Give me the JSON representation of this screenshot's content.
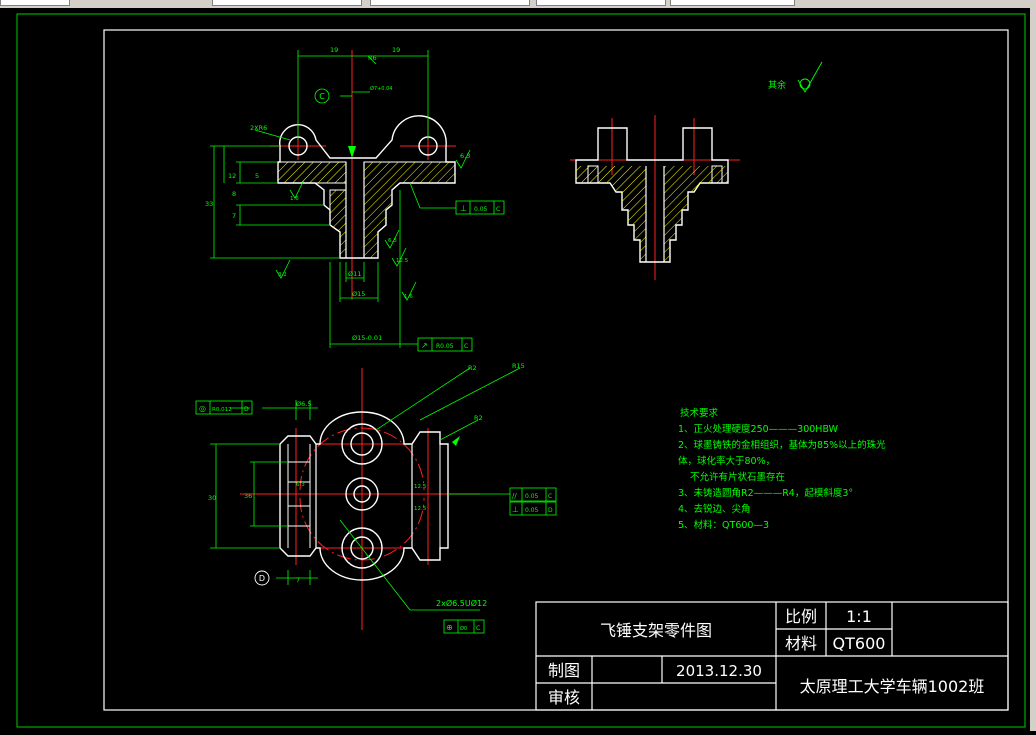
{
  "title_block": {
    "drawing_title": "飞锤支架零件图",
    "scale_label": "比例",
    "scale_value": "1:1",
    "material_label": "材料",
    "material_value": "QT600",
    "drawn_by_label": "制图",
    "date": "2013.12.30",
    "checked_by_label": "审核",
    "school": "太原理工大学车辆1002班"
  },
  "notes": {
    "heading": "技术要求",
    "lines": [
      "1、正火处理硬度250———300HBW",
      "2、球墨铸铁的金相组织，基体为85%以上的珠光",
      "体，球化率大于80%，",
      "不允许有片状石墨存在",
      "3、未铸造圆角R2———R4，起模斜度3°",
      "4、去锐边、尖角",
      "5、材料：QT600—3"
    ]
  },
  "surface_finish_note": "其余",
  "dimensions": {
    "top_w1": "19",
    "top_w2": "19",
    "r_top": "R6",
    "bore_tol": "Ø7+0.04",
    "holes_2xr6": "2XR6",
    "h33": "33",
    "h5": "5",
    "h7": "7",
    "h8": "8",
    "h12": "12",
    "d11": "Ø11",
    "d15": "Ø15",
    "d15_tol": "Ø15-0.01",
    "r6_3": "6.3",
    "r1_6a": "1.6",
    "r1_6b": "1.6",
    "r12_5": "12.5",
    "r3_2": "3.2",
    "r6_3b": "6.3",
    "w30": "30",
    "w36": "36",
    "h6_5": "Ø6.5",
    "dist7": "7",
    "r2": "R2",
    "r15": "R15",
    "r2b": "R2",
    "holes_note": "2xØ6.5UØ12",
    "rough12_5a": "12.5",
    "rough12_5b": "12.5",
    "rough6_3c": "6.3"
  },
  "datums": {
    "c": "C",
    "d": "D"
  },
  "tolerance_frames": {
    "perp_1": {
      "sym": "⊥",
      "val": "0.05",
      "ref": "C"
    },
    "runout": {
      "sym": "↗",
      "val": "R0.05",
      "ref": "C"
    },
    "conc": {
      "sym": "◎",
      "val": "R0.012",
      "ref": "D"
    },
    "para": {
      "sym": "//",
      "val": "0.05",
      "ref": "C"
    },
    "perp_2": {
      "sym": "⊥",
      "val": "0.05",
      "ref": "D"
    },
    "pos": {
      "sym": "⊕",
      "val": "Ø0",
      "ref": "C"
    }
  },
  "colors": {
    "outline": "#ffffff",
    "dimension": "#00ff00",
    "center": "#ff2020",
    "hatch": "#ffff00",
    "frame": "#ffffff"
  }
}
